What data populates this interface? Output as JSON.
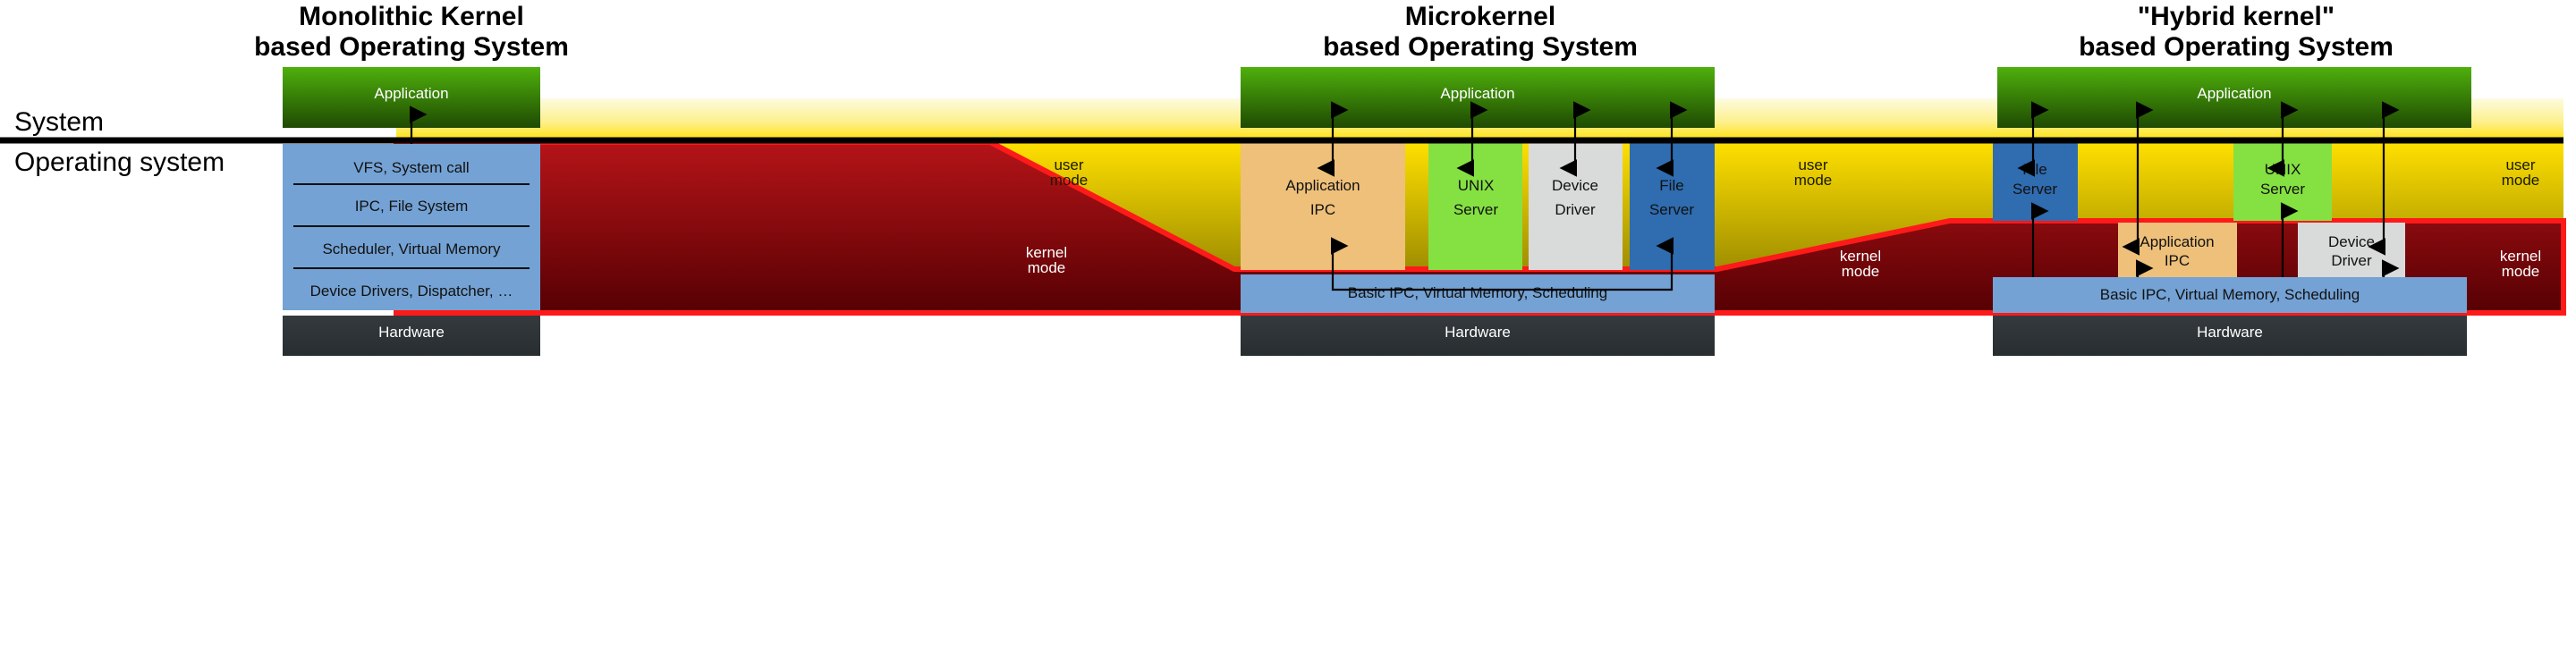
{
  "axis_labels": {
    "system": "System",
    "operating_system": "Operating system"
  },
  "colors": {
    "user_band_top": "#fdfbe0",
    "user_band_bottom": "#ffe000",
    "user_mode_fill": "#efd600",
    "kernel_red": "#b01317",
    "kernel_red_dark": "#6d0003",
    "red_outline": "#ff1a1a",
    "application_green_top": "#4aa80c",
    "application_green_bottom": "#234f04",
    "kernel_blue": "#74a2d4",
    "hardware": "#2f3538",
    "ipc_tan": "#eec07a",
    "unix_green": "#85e042",
    "device_gray": "#d9dada",
    "file_blue": "#2f6cb0",
    "divider_black": "#000000"
  },
  "columns": [
    {
      "id": "monolithic",
      "title_line1": "Monolithic Kernel",
      "title_line2": "based Operating System",
      "application_label": "Application",
      "kernel_mode_label_line1": "kernel",
      "kernel_mode_label_line2": "mode",
      "kernel_stack": [
        "VFS, System call",
        "IPC, File System",
        "Scheduler, Virtual Memory",
        "Device Drivers, Dispatcher, …"
      ],
      "hardware_label": "Hardware"
    },
    {
      "id": "microkernel",
      "title_line1": "Microkernel",
      "title_line2": "based Operating System",
      "application_label": "Application",
      "user_mode_label_line1": "user",
      "user_mode_label_line2": "mode",
      "kernel_mode_label_line1": "kernel",
      "kernel_mode_label_line2": "mode",
      "servers": [
        {
          "line1": "Application",
          "line2": "IPC",
          "color": "#eec07a"
        },
        {
          "line1": "UNIX",
          "line2": "Server",
          "color": "#85e042"
        },
        {
          "line1": "Device",
          "line2": "Driver",
          "color": "#d9dada"
        },
        {
          "line1": "File",
          "line2": "Server",
          "color": "#2f6cb0"
        }
      ],
      "microkernel_label": "Basic IPC, Virtual Memory, Scheduling",
      "hardware_label": "Hardware"
    },
    {
      "id": "hybrid",
      "title_line1": "\"Hybrid kernel\"",
      "title_line2": "based Operating System",
      "application_label": "Application",
      "user_mode_label_line1": "user",
      "user_mode_label_line2": "mode",
      "kernel_mode_label_line1": "kernel",
      "kernel_mode_label_line2": "mode",
      "user_servers": [
        {
          "line1": "File",
          "line2": "Server",
          "color": "#2f6cb0"
        },
        {
          "line1": "UNIX",
          "line2": "Server",
          "color": "#85e042"
        }
      ],
      "kernel_servers": [
        {
          "line1": "Application",
          "line2": "IPC",
          "color": "#eec07a"
        },
        {
          "line1": "Device",
          "line2": "Driver",
          "color": "#d9dada"
        }
      ],
      "microkernel_label": "Basic IPC, Virtual Memory, Scheduling",
      "hardware_label": "Hardware"
    }
  ],
  "mid_gaps": [
    {
      "user_mode_line1": "user",
      "user_mode_line2": "mode",
      "kernel_mode_line1": "kernel",
      "kernel_mode_line2": "mode"
    },
    {
      "user_mode_line1": "user",
      "user_mode_line2": "mode",
      "kernel_mode_line1": "kernel",
      "kernel_mode_line2": "mode"
    }
  ],
  "right_edge": {
    "user_mode_line1": "user",
    "user_mode_line2": "mode",
    "kernel_mode_line1": "kernel",
    "kernel_mode_line2": "mode"
  }
}
